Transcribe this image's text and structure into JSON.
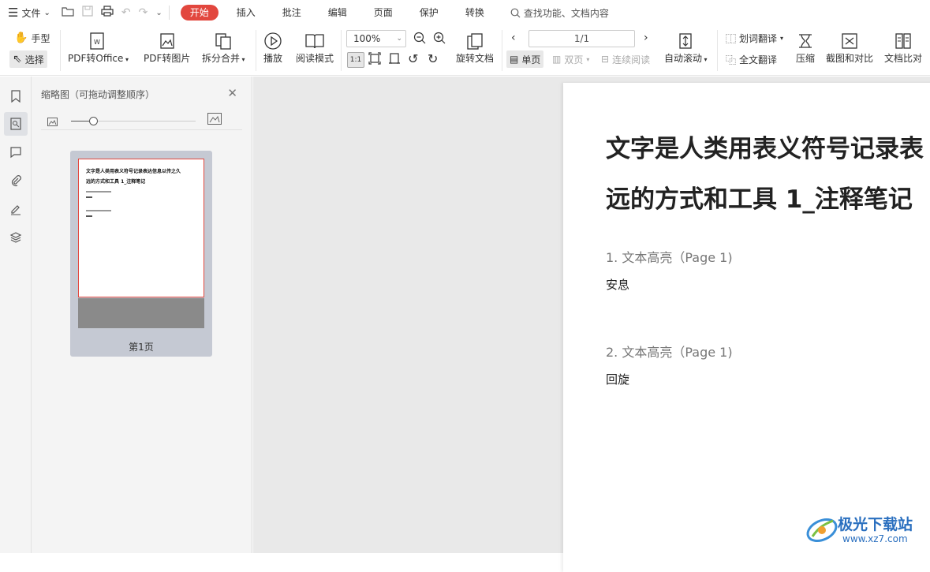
{
  "menubar": {
    "file_label": "文件",
    "tabs": [
      "开始",
      "插入",
      "批注",
      "编辑",
      "页面",
      "保护",
      "转换"
    ],
    "search_label": "查找功能、文档内容"
  },
  "toolbar": {
    "hand_label": "手型",
    "select_label": "选择",
    "pdf_to_office": "PDF转Office",
    "pdf_to_image": "PDF转图片",
    "split_merge": "拆分合并",
    "play": "播放",
    "read_mode": "阅读模式",
    "zoom_value": "100%",
    "rotate_doc": "旋转文档",
    "page_value": "1/1",
    "single_page": "单页",
    "double_page": "双页",
    "continuous": "连续阅读",
    "auto_scroll": "自动滚动",
    "word_translate": "划词翻译",
    "full_translate": "全文翻译",
    "compress": "压缩",
    "crop_compare": "截图和对比",
    "doc_compare": "文档比对",
    "fit_label": "1:1"
  },
  "thumbnail_panel": {
    "title": "缩略图（可拖动调整顺序）",
    "slider_value": 0.18,
    "page_label": "第1页"
  },
  "document": {
    "title_line1": "文字是人类用表义符号记录表",
    "title_line2": "远的方式和工具 1_注释笔记",
    "items": [
      {
        "heading": "1. 文本高亮（Page 1)",
        "body": "安息"
      },
      {
        "heading": "2. 文本高亮（Page 1)",
        "body": "回旋"
      }
    ]
  },
  "thumbnail_text": {
    "line1": "文字是人类用表义符号记录表达信息以传之久",
    "line2": "远的方式和工具 1_注释笔记"
  },
  "watermark": {
    "title": "极光下载站",
    "url": "www.xz7.com"
  }
}
